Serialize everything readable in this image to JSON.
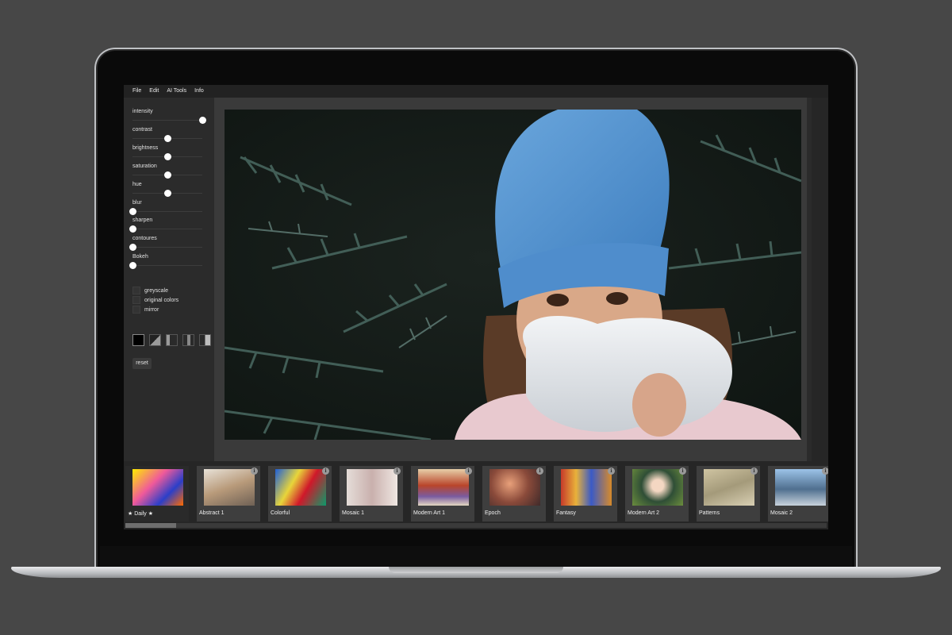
{
  "menu": {
    "items": [
      "File",
      "Edit",
      "AI Tools",
      "Info"
    ]
  },
  "sidebar": {
    "sliders": [
      {
        "label": "intensity",
        "value": 1.0
      },
      {
        "label": "contrast",
        "value": 0.5
      },
      {
        "label": "brightness",
        "value": 0.5
      },
      {
        "label": "saturation",
        "value": 0.5
      },
      {
        "label": "hue",
        "value": 0.5
      },
      {
        "label": "blur",
        "value": 0.0
      },
      {
        "label": "sharpen",
        "value": 0.0
      },
      {
        "label": "contoures",
        "value": 0.0
      },
      {
        "label": "Bokeh",
        "value": 0.0
      }
    ],
    "checkboxes": [
      {
        "label": "greyscale"
      },
      {
        "label": "original colors"
      },
      {
        "label": "mirror"
      }
    ],
    "fill_buttons": [
      "solid-black-icon",
      "diagonal-split-icon",
      "gradient-left-icon",
      "stepped-icon",
      "vertical-split-icon"
    ],
    "reset_label": "reset"
  },
  "filmstrip": {
    "styles": [
      {
        "label": "★ Daily ★",
        "selected": true,
        "info": false
      },
      {
        "label": "Abstract 1",
        "info": true
      },
      {
        "label": "Colorful",
        "info": true
      },
      {
        "label": "Mosaic 1",
        "info": true
      },
      {
        "label": "Modern Art 1",
        "info": true
      },
      {
        "label": "Epoch",
        "info": true
      },
      {
        "label": "Fantasy",
        "info": true
      },
      {
        "label": "Modern Art 2",
        "info": true
      },
      {
        "label": "Patterns",
        "info": true
      },
      {
        "label": "Mosaic 2",
        "info": true
      }
    ],
    "info_glyph": "i"
  },
  "colors": {
    "background": "#474747",
    "app_bg": "#2b2b2b",
    "panel": "#3a3a3a",
    "knob": "#ffffff"
  }
}
